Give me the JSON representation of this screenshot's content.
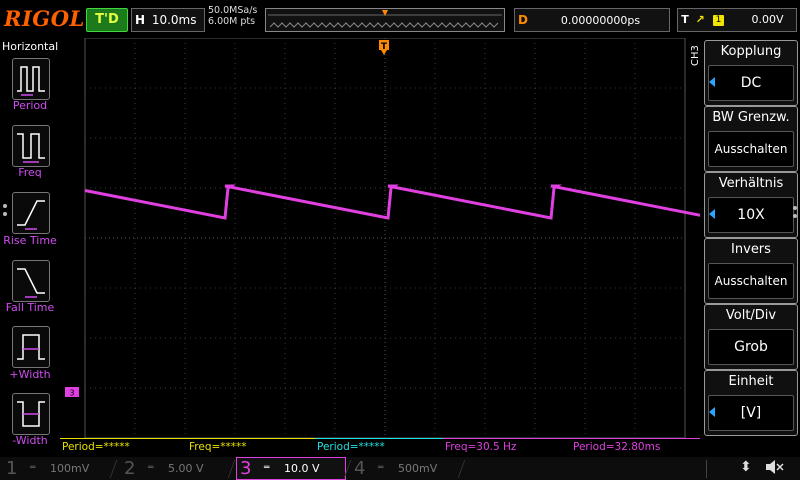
{
  "header": {
    "logo": "RIGOL",
    "run_status": "T'D",
    "timebase_letter": "H",
    "timebase": "10.0ms",
    "sample_rate": "50.0MSa/s",
    "memory_depth": "6.00M pts",
    "delay_letter": "D",
    "delay": "0.00000000ps",
    "trigger_letter": "T",
    "trigger_source": "1",
    "trigger_level": "0.00V"
  },
  "left_menu": {
    "title": "Horizontal",
    "items": [
      {
        "label": "Period"
      },
      {
        "label": "Freq"
      },
      {
        "label": "Rise Time"
      },
      {
        "label": "Fall Time"
      },
      {
        "label": "+Width"
      },
      {
        "label": "-Width"
      }
    ]
  },
  "right_menu": {
    "channel_tag": "CH3",
    "items": [
      {
        "title": "Kopplung",
        "value": "DC"
      },
      {
        "title": "BW Grenzw.",
        "value": "Ausschalten"
      },
      {
        "title": "Verhältnis",
        "value": "10X"
      },
      {
        "title": "Invers",
        "value": "Ausschalten"
      },
      {
        "title": "Volt/Div",
        "value": "Grob"
      },
      {
        "title": "Einheit",
        "value": "[V]"
      }
    ]
  },
  "measurements": [
    {
      "label": "Period=*****",
      "color": "#e8e000"
    },
    {
      "label": "Freq=*****",
      "color": "#e8e000"
    },
    {
      "label": "Period=*****",
      "color": "#20e0e0"
    },
    {
      "label": "Freq=30.5 Hz",
      "color": "#e040e0"
    },
    {
      "label": "Period=32.80ms",
      "color": "#e040e0"
    }
  ],
  "channels": [
    {
      "num": "1",
      "scale": "100mV",
      "color": "#e8e000",
      "active": false
    },
    {
      "num": "2",
      "scale": "5.00 V",
      "color": "#20e0e0",
      "active": false
    },
    {
      "num": "3",
      "scale": "10.0 V",
      "color": "#e040e0",
      "active": true
    },
    {
      "num": "4",
      "scale": "500mV",
      "color": "#2a6cff",
      "active": false
    }
  ],
  "waveform": {
    "channel_marker": "3",
    "color": "#e040e0",
    "shape": "sawtooth (sharp rise, slow linear decay)",
    "trigger_marker": "T"
  },
  "colors": {
    "accent": "#ff6000",
    "trigger": "#f0e400",
    "grid": "#3a3a3a"
  }
}
